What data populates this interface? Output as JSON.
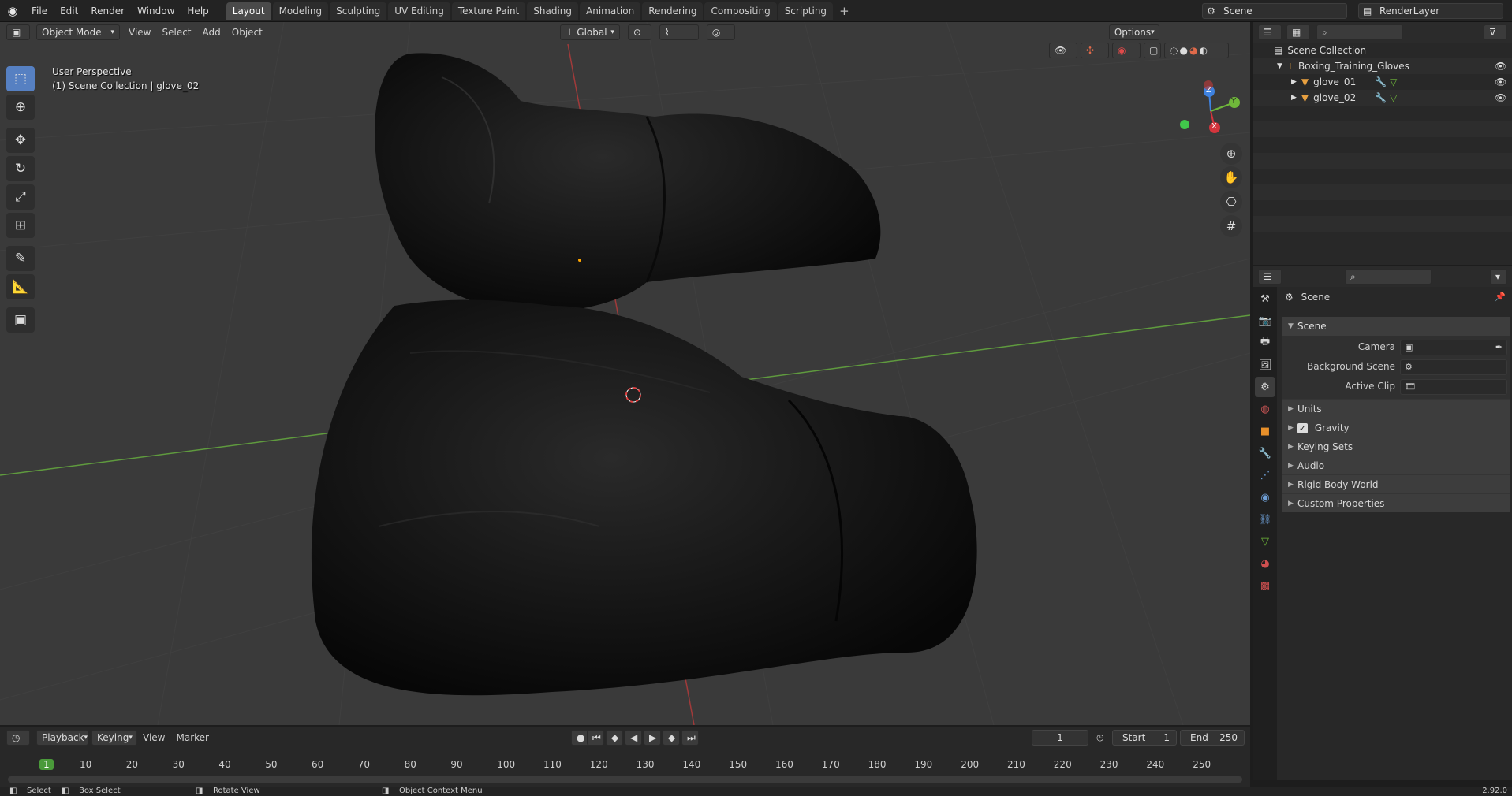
{
  "topbar": {
    "menus": [
      "File",
      "Edit",
      "Render",
      "Window",
      "Help"
    ],
    "workspaces": [
      {
        "label": "Layout",
        "active": true
      },
      {
        "label": "Modeling"
      },
      {
        "label": "Sculpting"
      },
      {
        "label": "UV Editing"
      },
      {
        "label": "Texture Paint"
      },
      {
        "label": "Shading"
      },
      {
        "label": "Animation"
      },
      {
        "label": "Rendering"
      },
      {
        "label": "Compositing"
      },
      {
        "label": "Scripting"
      }
    ],
    "add_tab": "+",
    "scene_name": "Scene",
    "view_layer": "RenderLayer"
  },
  "viewport_header": {
    "mode": "Object Mode",
    "menus": [
      "View",
      "Select",
      "Add",
      "Object"
    ],
    "transform_orientation": "Global",
    "options": "Options"
  },
  "viewport": {
    "perspective": "User Perspective",
    "collection_info": "(1) Scene Collection | glove_02",
    "gizmo": {
      "x": "X",
      "y": "Y",
      "z": "Z"
    }
  },
  "outliner": {
    "root": "Scene Collection",
    "collection": "Boxing_Training_Gloves",
    "objects": [
      "glove_01",
      "glove_02"
    ]
  },
  "properties": {
    "context": "Scene",
    "panel": "Scene",
    "fields": {
      "camera_label": "Camera",
      "background_label": "Background Scene",
      "clip_label": "Active Clip"
    },
    "subpanels": [
      "Units",
      "Gravity",
      "Keying Sets",
      "Audio",
      "Rigid Body World",
      "Custom Properties"
    ],
    "gravity_checked": true
  },
  "timeline": {
    "menus": [
      "Playback",
      "Keying",
      "View",
      "Marker"
    ],
    "current_frame": "1",
    "start_label": "Start",
    "start": "1",
    "end_label": "End",
    "end": "250",
    "ticks": [
      "1",
      "10",
      "20",
      "30",
      "40",
      "50",
      "60",
      "70",
      "80",
      "90",
      "100",
      "110",
      "120",
      "130",
      "140",
      "150",
      "160",
      "170",
      "180",
      "190",
      "200",
      "210",
      "220",
      "230",
      "240",
      "250"
    ]
  },
  "statusbar": {
    "select": "Select",
    "box_select": "Box Select",
    "rotate": "Rotate View",
    "context_menu": "Object Context Menu",
    "version": "2.92.0"
  },
  "colors": {
    "accent": "#5680c2",
    "active_tab": "#4a4a4a",
    "x_axis": "#d4353d",
    "y_axis": "#6fb73a",
    "z_axis": "#3e82e0",
    "glove": "#111111"
  }
}
